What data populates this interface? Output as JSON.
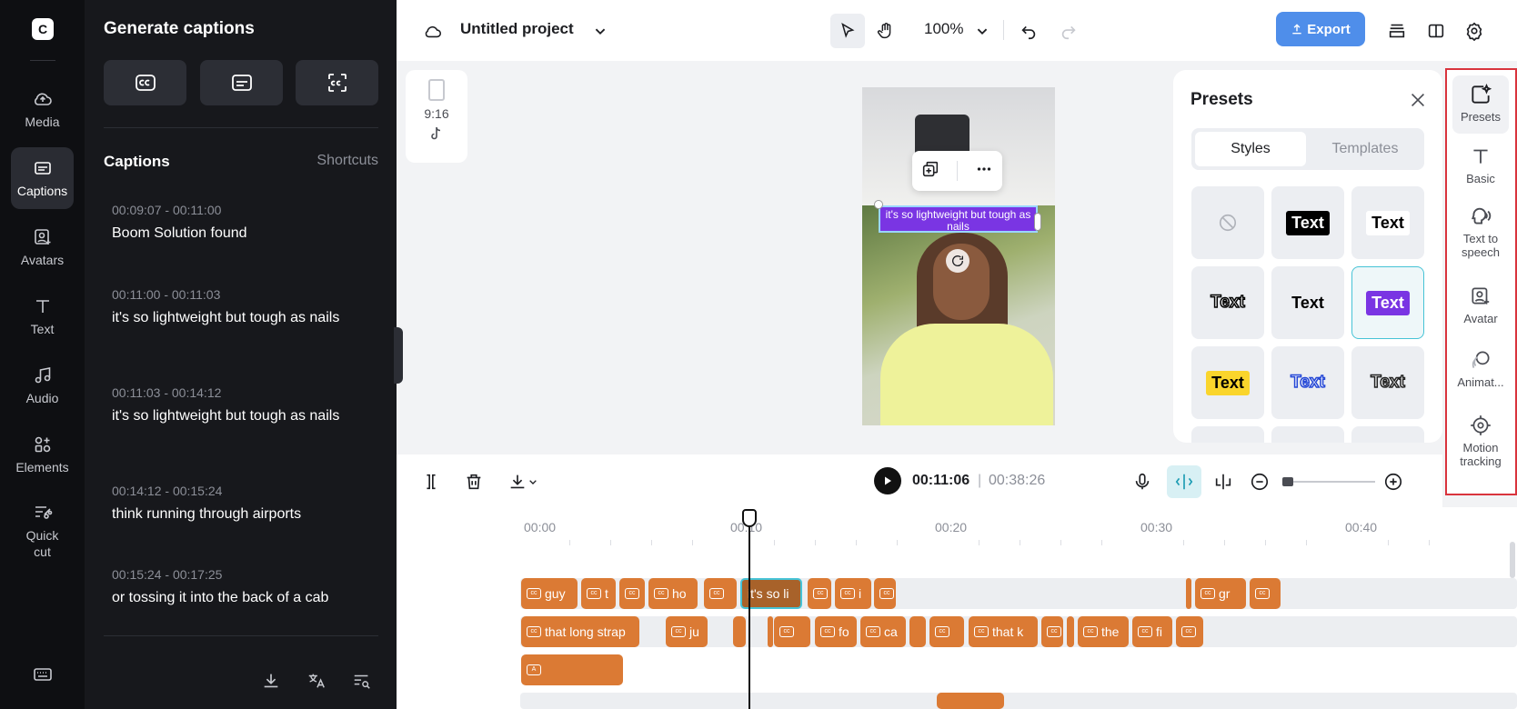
{
  "app": {
    "logo_glyph": "C",
    "accent_color": "#4f8eea",
    "clip_color": "#db7a34"
  },
  "rail": {
    "items": [
      {
        "label": "Media",
        "icon": "cloud-upload-icon"
      },
      {
        "label": "Captions",
        "icon": "captions-icon",
        "active": true
      },
      {
        "label": "Avatars",
        "icon": "avatar-icon"
      },
      {
        "label": "Text",
        "icon": "text-icon"
      },
      {
        "label": "Audio",
        "icon": "music-note-icon"
      },
      {
        "label": "Elements",
        "icon": "elements-icon"
      },
      {
        "label": "Quick cut",
        "icon": "quick-cut-icon"
      }
    ]
  },
  "panel": {
    "title": "Generate captions",
    "captions_heading": "Captions",
    "shortcuts_label": "Shortcuts",
    "captions": [
      {
        "time": "00:09:07 - 00:11:00",
        "text": "Boom Solution found"
      },
      {
        "time": "00:11:00 - 00:11:03",
        "text": "it's so lightweight but tough as nails"
      },
      {
        "time": "00:11:03 - 00:14:12",
        "text": "it's so lightweight but tough as nails"
      },
      {
        "time": "00:14:12 - 00:15:24",
        "text": "think running through airports"
      },
      {
        "time": "00:15:24 - 00:17:25",
        "text": "or tossing it into the back of a cab"
      }
    ]
  },
  "topbar": {
    "project_name": "Untitled project",
    "zoom": "100%",
    "export_label": "Export"
  },
  "canvas": {
    "ratio_label": "9:16",
    "caption_overlay": "it's so lightweight but tough as nails"
  },
  "presets": {
    "title": "Presets",
    "tabs": [
      "Styles",
      "Templates"
    ],
    "tiles": [
      {
        "label": "",
        "style": "none"
      },
      {
        "label": "Text",
        "style": "black-box"
      },
      {
        "label": "Text",
        "style": "white-box"
      },
      {
        "label": "Text",
        "style": "outline"
      },
      {
        "label": "Text",
        "style": "plain"
      },
      {
        "label": "Text",
        "style": "purple-box",
        "selected": true
      },
      {
        "label": "Text",
        "style": "yellow-box"
      },
      {
        "label": "Text",
        "style": "blue-outline"
      },
      {
        "label": "Text",
        "style": "dark-outline"
      }
    ]
  },
  "toolrail": {
    "items": [
      {
        "label": "Presets",
        "icon": "presets-icon",
        "selected": true
      },
      {
        "label": "Basic",
        "icon": "text-icon"
      },
      {
        "label": "Text to speech",
        "icon": "text-to-speech-icon"
      },
      {
        "label": "Avatar",
        "icon": "avatar-icon"
      },
      {
        "label": "Animat...",
        "icon": "animation-icon"
      },
      {
        "label": "Motion tracking",
        "icon": "motion-tracking-icon"
      }
    ]
  },
  "timeline": {
    "current_time": "00:11:06",
    "separator": "|",
    "total_time": "00:38:26",
    "ruler": [
      "00:00",
      "00:10",
      "00:20",
      "00:30",
      "00:40"
    ],
    "track1_clips": [
      "guy",
      "t",
      "",
      "ho",
      "",
      "it's so li",
      "",
      "i",
      "",
      "gr",
      ""
    ],
    "track2_clips": [
      "that long strap",
      "ju",
      "",
      "",
      "",
      "fo",
      "ca",
      "",
      "",
      "that k",
      "",
      "",
      "the",
      "fi",
      ""
    ],
    "track3_clips": [
      ""
    ]
  }
}
